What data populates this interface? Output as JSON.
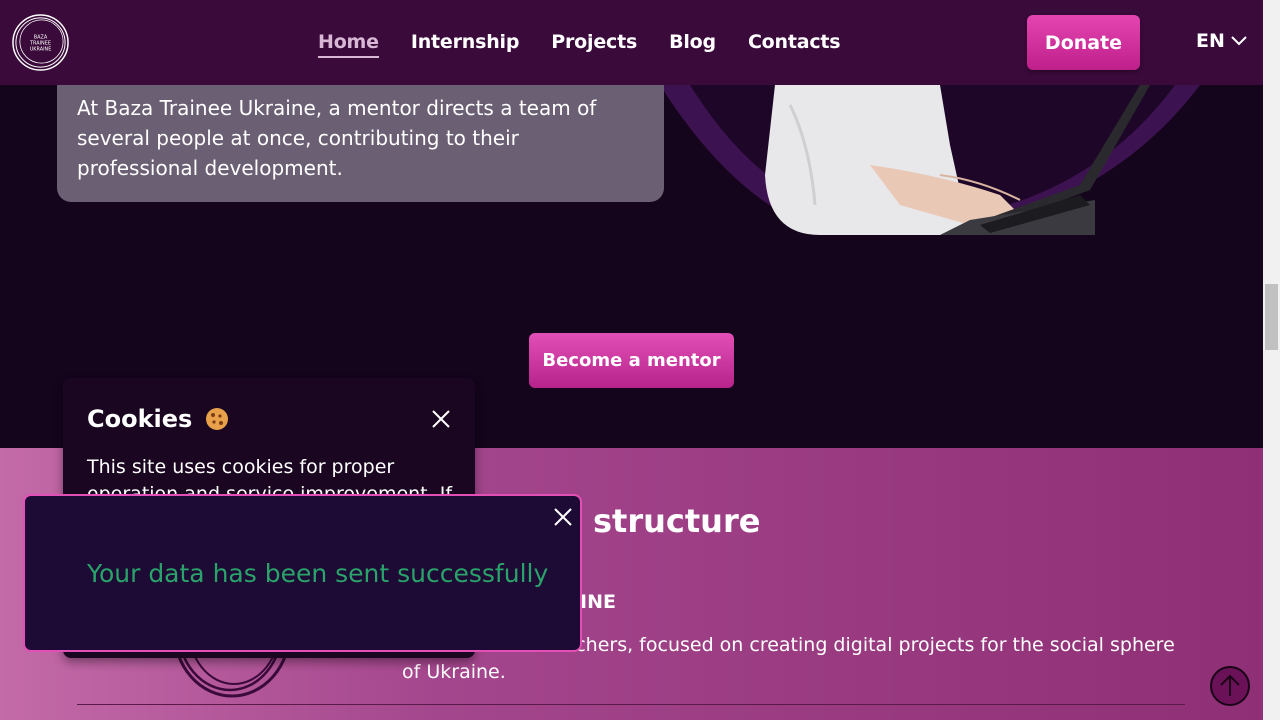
{
  "header": {
    "logo_text": "BAZA TRAINEE UKRAINE",
    "nav": [
      {
        "label": "Home"
      },
      {
        "label": "Internship"
      },
      {
        "label": "Projects"
      },
      {
        "label": "Blog"
      },
      {
        "label": "Contacts"
      }
    ],
    "donate_label": "Donate",
    "language": "EN"
  },
  "hero": {
    "quote": "At Baza Trainee Ukraine, a mentor directs a team of several people at once, contributing to their professional development.",
    "become_mentor_label": "Become a mentor"
  },
  "structure": {
    "title_partial": "structure",
    "subtitle_partial": "INE",
    "description": "juniors and IT switchers, focused on creating digital projects for the social sphere of Ukraine."
  },
  "cookies": {
    "title": "Cookies",
    "text": "This site uses cookies for proper operation and service improvement. If"
  },
  "toast": {
    "message": "Your data has been sent successfully"
  },
  "colors": {
    "header_bg": "#3a0a3a",
    "accent_pink": "#e24fb6",
    "success_green": "#2aa36a",
    "dark_bg": "#14041c"
  }
}
